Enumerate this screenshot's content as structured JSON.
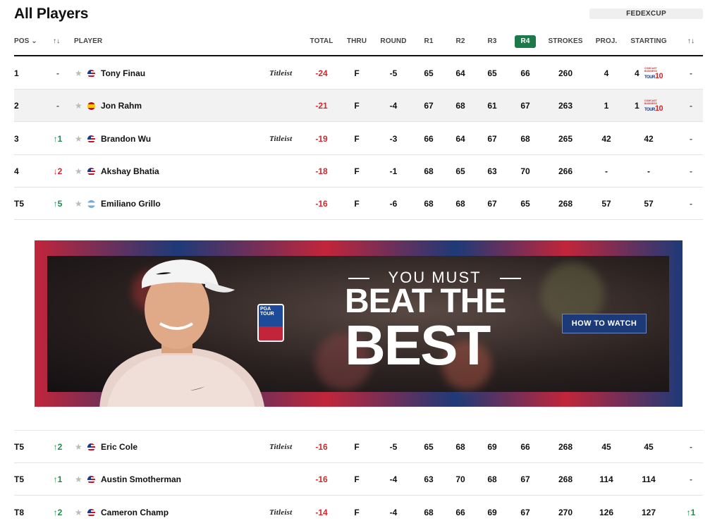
{
  "header": {
    "title": "All Players",
    "fedex_label": "FEDEXCUP"
  },
  "columns": {
    "pos": "POS ⌄",
    "move": "↑↓",
    "player": "PLAYER",
    "total": "TOTAL",
    "thru": "THRU",
    "round": "ROUND",
    "r1": "R1",
    "r2": "R2",
    "r3": "R3",
    "r4": "R4",
    "strokes": "STROKES",
    "proj": "PROJ.",
    "starting": "STARTING",
    "sort": "↑↓"
  },
  "rows_top": [
    {
      "pos": "1",
      "move": "-",
      "player": "Tony Finau",
      "flag": "us",
      "sponsor": "Titleist",
      "total": "-24",
      "thru": "F",
      "round": "-5",
      "r1": "65",
      "r2": "64",
      "r3": "65",
      "r4": "66",
      "strokes": "260",
      "proj": "4",
      "starting": "4",
      "top10": true,
      "last": "-"
    },
    {
      "pos": "2",
      "move": "-",
      "player": "Jon Rahm",
      "flag": "es",
      "sponsor": "",
      "total": "-21",
      "thru": "F",
      "round": "-4",
      "r1": "67",
      "r2": "68",
      "r3": "61",
      "r4": "67",
      "strokes": "263",
      "proj": "1",
      "starting": "1",
      "top10": true,
      "last": "-"
    },
    {
      "pos": "3",
      "move": "↑1",
      "player": "Brandon Wu",
      "flag": "us",
      "sponsor": "Titleist",
      "total": "-19",
      "thru": "F",
      "round": "-3",
      "r1": "66",
      "r2": "64",
      "r3": "67",
      "r4": "68",
      "strokes": "265",
      "proj": "42",
      "starting": "42",
      "top10": false,
      "last": "-"
    },
    {
      "pos": "4",
      "move": "↓2",
      "player": "Akshay Bhatia",
      "flag": "us",
      "sponsor": "",
      "total": "-18",
      "thru": "F",
      "round": "-1",
      "r1": "68",
      "r2": "65",
      "r3": "63",
      "r4": "70",
      "strokes": "266",
      "proj": "-",
      "starting": "-",
      "top10": false,
      "last": "-"
    },
    {
      "pos": "T5",
      "move": "↑5",
      "player": "Emiliano Grillo",
      "flag": "ar",
      "sponsor": "",
      "total": "-16",
      "thru": "F",
      "round": "-6",
      "r1": "68",
      "r2": "68",
      "r3": "67",
      "r4": "65",
      "strokes": "268",
      "proj": "57",
      "starting": "57",
      "top10": false,
      "last": "-"
    }
  ],
  "rows_bottom": [
    {
      "pos": "T5",
      "move": "↑2",
      "player": "Eric Cole",
      "flag": "us",
      "sponsor": "Titleist",
      "total": "-16",
      "thru": "F",
      "round": "-5",
      "r1": "65",
      "r2": "68",
      "r3": "69",
      "r4": "66",
      "strokes": "268",
      "proj": "45",
      "starting": "45",
      "last": "-"
    },
    {
      "pos": "T5",
      "move": "↑1",
      "player": "Austin Smotherman",
      "flag": "us",
      "sponsor": "",
      "total": "-16",
      "thru": "F",
      "round": "-4",
      "r1": "63",
      "r2": "70",
      "r3": "68",
      "r4": "67",
      "strokes": "268",
      "proj": "114",
      "starting": "114",
      "last": "-"
    },
    {
      "pos": "T8",
      "move": "↑2",
      "player": "Cameron Champ",
      "flag": "us",
      "sponsor": "Titleist",
      "total": "-14",
      "thru": "F",
      "round": "-4",
      "r1": "68",
      "r2": "66",
      "r3": "69",
      "r4": "67",
      "strokes": "270",
      "proj": "126",
      "starting": "127",
      "last": "↑1"
    }
  ],
  "top10_badge": {
    "mini": "COMCAST BUSINESS",
    "tour": "TOUR",
    "num": "10"
  },
  "banner": {
    "line1": "YOU MUST",
    "line2": "BEAT THE",
    "line3": "BEST",
    "cta": "HOW TO WATCH",
    "logo_text": "PGA TOUR"
  },
  "colors": {
    "accent_green": "#1c7a4a",
    "negative_red": "#d0282e",
    "navy": "#1d3a78"
  }
}
